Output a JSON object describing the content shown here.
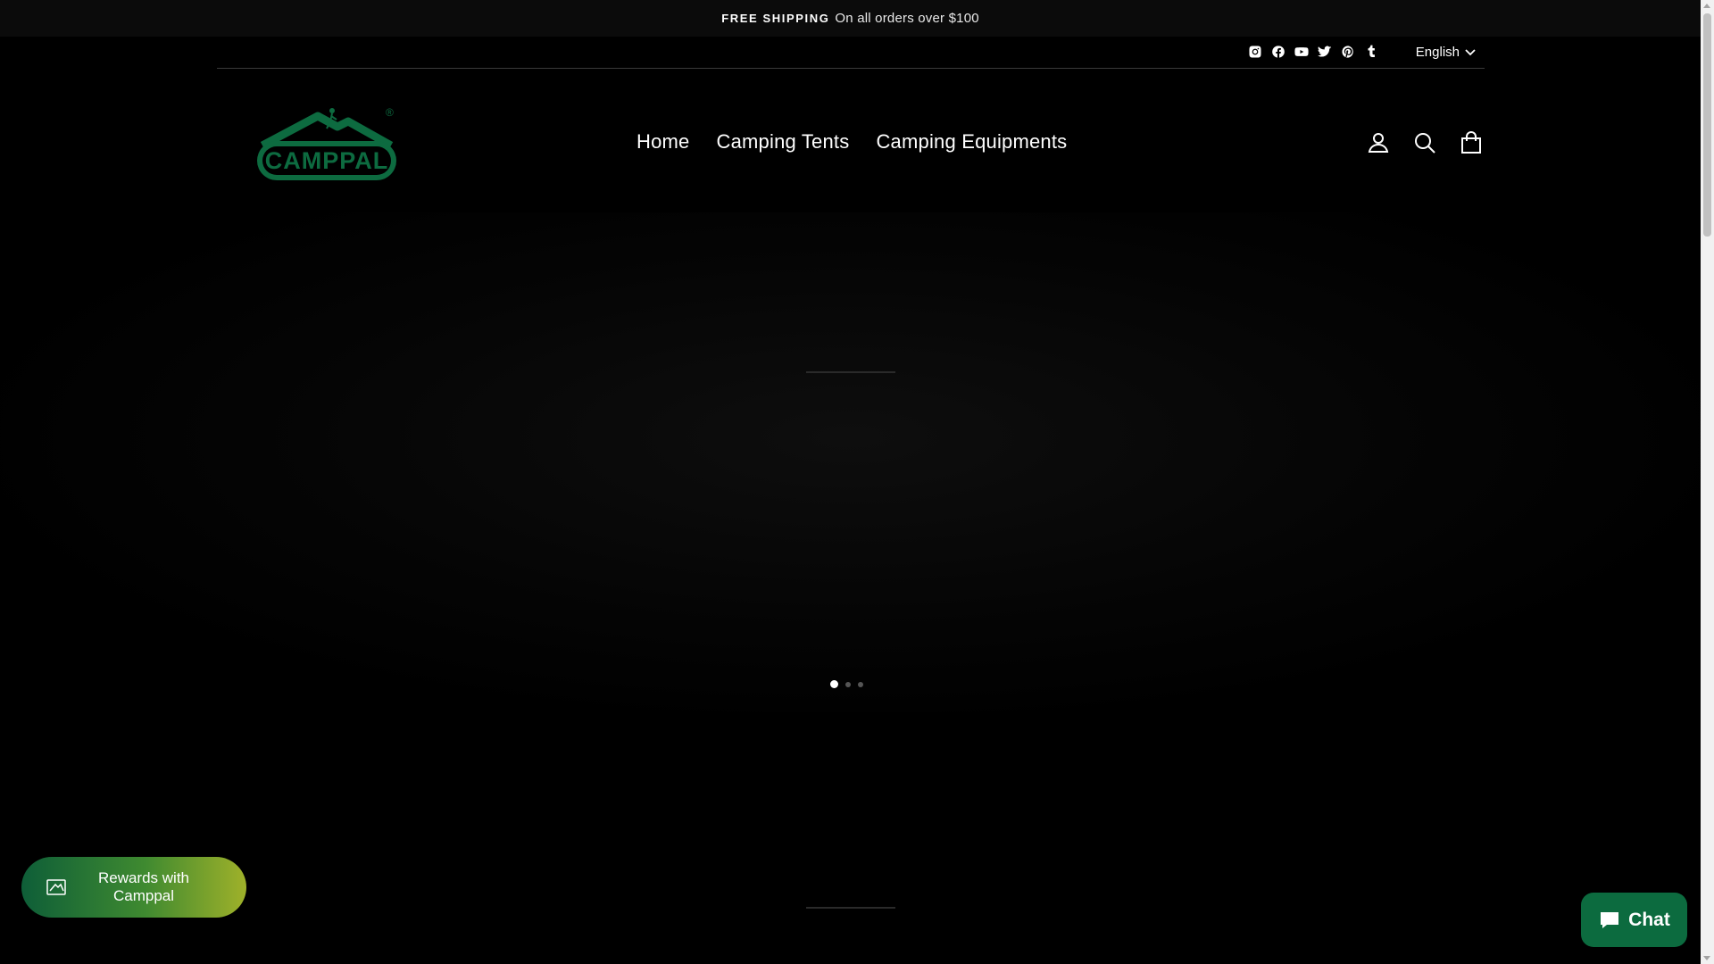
{
  "announcement": {
    "strong": "FREE SHIPPING",
    "text": "On all orders over $100"
  },
  "social_icons": [
    "instagram-icon",
    "facebook-icon",
    "youtube-icon",
    "twitter-icon",
    "pinterest-icon",
    "tumblr-icon"
  ],
  "language": {
    "selected": "English"
  },
  "logo": {
    "text": "CAMPPAL",
    "registered": "®",
    "color": "#0d6b40"
  },
  "nav": {
    "items": [
      "Home",
      "Camping Tents",
      "Camping Equipments"
    ]
  },
  "header_icons": [
    "account-icon",
    "search-icon",
    "cart-icon"
  ],
  "hero": {
    "slides": 3,
    "active_slide": 1
  },
  "rewards": {
    "label": "Rewards with Camppal"
  },
  "chat": {
    "label": "Chat"
  },
  "colors": {
    "background": "#000000",
    "brand_green": "#0c6b3f",
    "rewards_gradient_end": "#9fb12a"
  }
}
